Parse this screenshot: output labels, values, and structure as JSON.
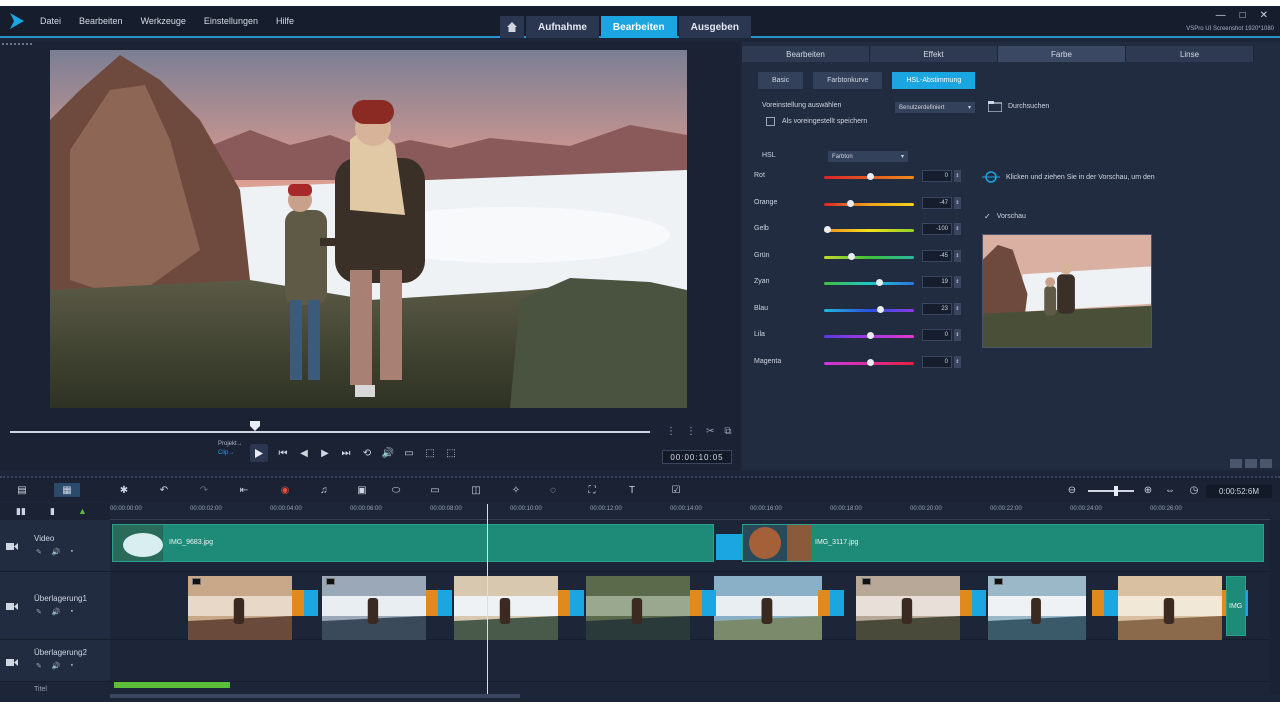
{
  "menu": [
    "Datei",
    "Bearbeiten",
    "Werkzeuge",
    "Einstellungen",
    "Hilfe"
  ],
  "modes": [
    {
      "label": "Aufnahme",
      "active": false
    },
    {
      "label": "Bearbeiten",
      "active": true
    },
    {
      "label": "Ausgeben",
      "active": false
    }
  ],
  "window_info": "VSPro UI Screenshot 1920*1080",
  "window_controls": [
    "—",
    "□",
    "✕"
  ],
  "preview": {
    "project_label": "Projekt→",
    "clip_label": "Clip→",
    "timecode": "00:00:10:05"
  },
  "right_panel": {
    "tabs": [
      "Bearbeiten",
      "Effekt",
      "Farbe",
      "Linse"
    ],
    "active_tab": 2,
    "subtabs": [
      "Basic",
      "Farbtonkurve",
      "HSL-Abstimmung"
    ],
    "active_subtab": 2,
    "preset_label": "Voreinstellung auswählen",
    "preset_value": "Benutzerdefiniert",
    "browse_label": "Durchsuchen",
    "save_preset_label": "Als voreingestellt speichern",
    "hsl_label": "HSL",
    "hsl_mode": "Farbton",
    "drag_hint": "Klicken und ziehen Sie in der Vorschau, um den",
    "preview_check_label": "Vorschau",
    "sliders": [
      {
        "label": "Rot",
        "value": "0",
        "pos": 0.5,
        "gradient": "linear-gradient(90deg,#d9242a,#f08a1c)"
      },
      {
        "label": "Orange",
        "value": "-47",
        "pos": 0.27,
        "gradient": "linear-gradient(90deg,#d9242a,#f0a21c,#f2d21c)"
      },
      {
        "label": "Gelb",
        "value": "-100",
        "pos": 0.0,
        "gradient": "linear-gradient(90deg,#f08a1c,#f2e21c,#8fd12a)"
      },
      {
        "label": "Grün",
        "value": "-45",
        "pos": 0.28,
        "gradient": "linear-gradient(90deg,#c8d82a,#3fbf3c,#2ab8a0)"
      },
      {
        "label": "Zyan",
        "value": "19",
        "pos": 0.6,
        "gradient": "linear-gradient(90deg,#3fbf3c,#1fc8c8,#2a78e0)"
      },
      {
        "label": "Blau",
        "value": "23",
        "pos": 0.62,
        "gradient": "linear-gradient(90deg,#1fb8d8,#2a52e0,#8a3ae0)"
      },
      {
        "label": "Lila",
        "value": "0",
        "pos": 0.5,
        "gradient": "linear-gradient(90deg,#5a3ae0,#a43ae0,#e03ac8)"
      },
      {
        "label": "Magenta",
        "value": "0",
        "pos": 0.5,
        "gradient": "linear-gradient(90deg,#c83ae0,#e02a9a,#e0243a)"
      }
    ]
  },
  "timeline": {
    "time": "0:00:52:6M",
    "ruler": [
      "00:00:00:00",
      "00:00:02:00",
      "00:00:04:00",
      "00:00:06:00",
      "00:00:08:00",
      "00:00:10:00",
      "00:00:12:00",
      "00:00:14:00",
      "00:00:16:00",
      "00:00:18:00",
      "00:00:20:00",
      "00:00:22:00",
      "00:00:24:00",
      "00:00:26:00"
    ],
    "tracks": [
      {
        "name": "Video"
      },
      {
        "name": "Überlagerung1"
      },
      {
        "name": "Überlagerung2"
      },
      {
        "name": "Titel"
      }
    ],
    "video_clips": [
      "IMG_9683.jpg",
      "IMG_3117.jpg"
    ],
    "overlay_end_label": "IMG"
  }
}
